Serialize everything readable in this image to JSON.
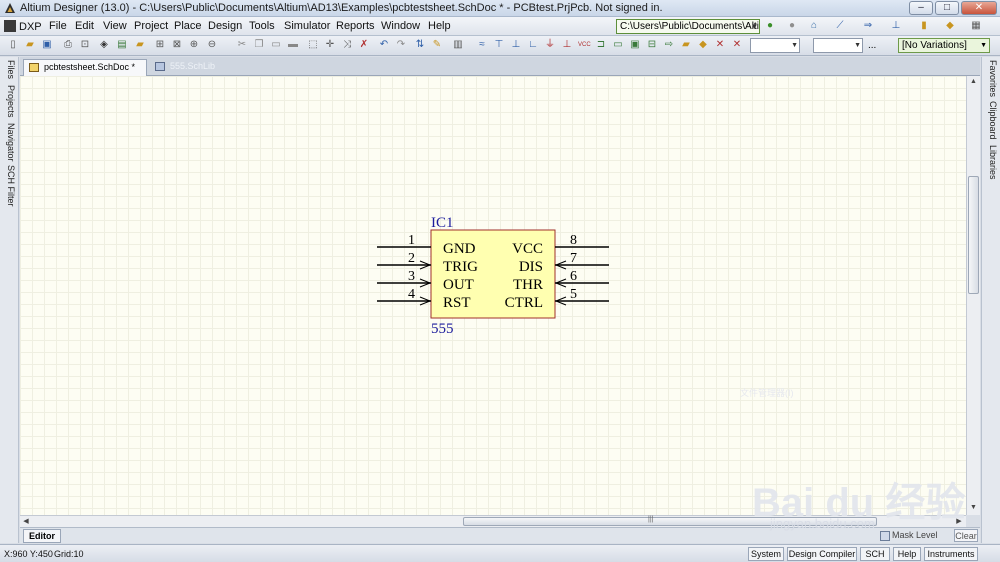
{
  "window": {
    "title": "Altium Designer (13.0) - C:\\Users\\Public\\Documents\\Altium\\AD13\\Examples\\pcbtestsheet.SchDoc * - PCBtest.PrjPcb. Not signed in.",
    "minimize": "–",
    "maximize": "□",
    "close": "✕"
  },
  "menubar": {
    "items": [
      "DXP",
      "File",
      "Edit",
      "View",
      "Project",
      "Place",
      "Design",
      "Tools",
      "Simulator",
      "Reports",
      "Window",
      "Help"
    ],
    "path_value": "C:\\Users\\Public\\Documents\\Alti"
  },
  "toolbar": {
    "combo1": "",
    "combo2": "",
    "more": "...",
    "variations": "[No Variations]"
  },
  "left_panels": [
    "Files",
    "Projects",
    "Navigator",
    "SCH Filter"
  ],
  "right_panels": [
    "Favorites",
    "Clipboard",
    "Libraries"
  ],
  "doc_tabs": {
    "active": "pcbtestsheet.SchDoc *",
    "inactive": "555.SchLib"
  },
  "component": {
    "designator": "IC1",
    "comment": "555",
    "pins_left": [
      {
        "number": "1",
        "name": "GND"
      },
      {
        "number": "2",
        "name": "TRIG"
      },
      {
        "number": "3",
        "name": "OUT"
      },
      {
        "number": "4",
        "name": "RST"
      }
    ],
    "pins_right": [
      {
        "number": "8",
        "name": "VCC"
      },
      {
        "number": "7",
        "name": "DIS"
      },
      {
        "number": "6",
        "name": "THR"
      },
      {
        "number": "5",
        "name": "CTRL"
      }
    ],
    "body_color": "#ffffb0",
    "border_color": "#a0302a",
    "label_color": "#1c1c9c"
  },
  "panel_tabs": {
    "editor": "Editor",
    "mask_level": "Mask Level",
    "clear": "Clear"
  },
  "status": {
    "coords": "X:960 Y:450",
    "grid": "Grid:10",
    "buttons": [
      "System",
      "Design Compiler",
      "SCH",
      "Help",
      "Instruments"
    ]
  },
  "watermark": {
    "brand": "Bai du 经验",
    "url": "jingyan.baidu.com"
  }
}
